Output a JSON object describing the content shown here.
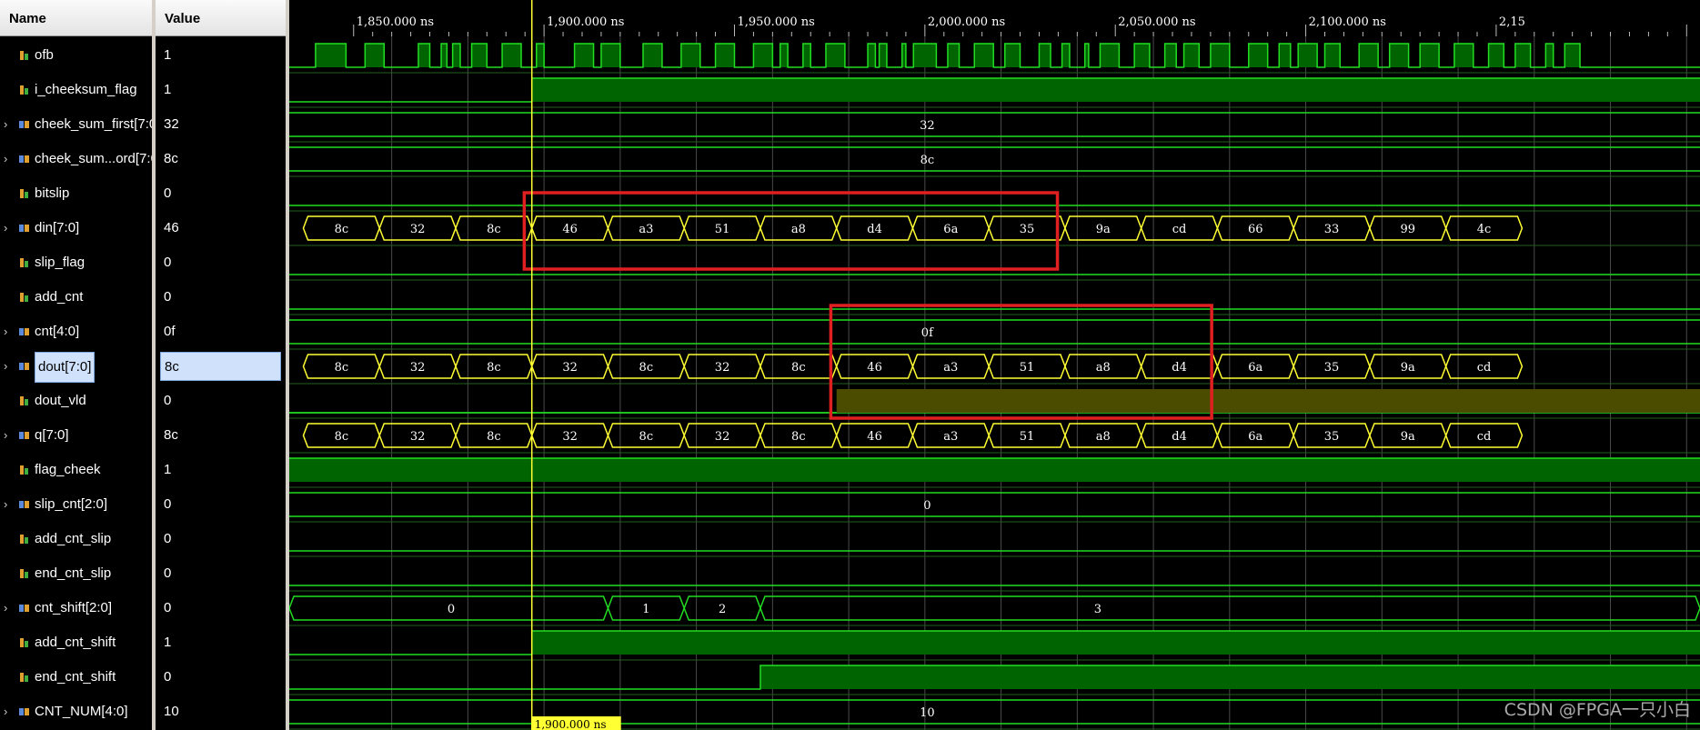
{
  "headers": {
    "name": "Name",
    "value": "Value"
  },
  "cursor_label": "1,900.000 ns",
  "timeline": {
    "ticks": [
      {
        "t": 1850,
        "label": "1,850.000 ns"
      },
      {
        "t": 1900,
        "label": "1,900.000 ns"
      },
      {
        "t": 1950,
        "label": "1,950.000 ns"
      },
      {
        "t": 2000,
        "label": "2,000.000 ns"
      },
      {
        "t": 2050,
        "label": "2,050.000 ns"
      },
      {
        "t": 2100,
        "label": "2,100.000 ns"
      },
      {
        "t": 2150,
        "label": "2,15"
      }
    ]
  },
  "signals": [
    {
      "name": "ofb",
      "value": "1",
      "bus": false
    },
    {
      "name": "i_cheeksum_flag",
      "value": "1",
      "bus": false
    },
    {
      "name": "cheek_sum_first[7:0]",
      "value": "32",
      "bus": true
    },
    {
      "name": "cheek_sum...ord[7:0]",
      "value": "8c",
      "bus": true
    },
    {
      "name": "bitslip",
      "value": "0",
      "bus": false
    },
    {
      "name": "din[7:0]",
      "value": "46",
      "bus": true
    },
    {
      "name": "slip_flag",
      "value": "0",
      "bus": false
    },
    {
      "name": "add_cnt",
      "value": "0",
      "bus": false
    },
    {
      "name": "cnt[4:0]",
      "value": "0f",
      "bus": true
    },
    {
      "name": "dout[7:0]",
      "value": "8c",
      "bus": true,
      "selected": true
    },
    {
      "name": "dout_vld",
      "value": "0",
      "bus": false
    },
    {
      "name": "q[7:0]",
      "value": "8c",
      "bus": true
    },
    {
      "name": "flag_cheek",
      "value": "1",
      "bus": false
    },
    {
      "name": "slip_cnt[2:0]",
      "value": "0",
      "bus": true
    },
    {
      "name": "add_cnt_slip",
      "value": "0",
      "bus": false
    },
    {
      "name": "end_cnt_slip",
      "value": "0",
      "bus": false
    },
    {
      "name": "cnt_shift[2:0]",
      "value": "0",
      "bus": true
    },
    {
      "name": "add_cnt_shift",
      "value": "1",
      "bus": false
    },
    {
      "name": "end_cnt_shift",
      "value": "0",
      "bus": false
    },
    {
      "name": "CNT_NUM[4:0]",
      "value": "10",
      "bus": true
    }
  ],
  "waves": {
    "cheek_sum_first": "32",
    "cheek_sum_second": "8c",
    "din": [
      "8c",
      "32",
      "8c",
      "46",
      "a3",
      "51",
      "a8",
      "d4",
      "6a",
      "35",
      "9a",
      "cd",
      "66",
      "33",
      "99",
      "4c"
    ],
    "cnt": "0f",
    "dout": [
      "8c",
      "32",
      "8c",
      "32",
      "8c",
      "32",
      "8c",
      "46",
      "a3",
      "51",
      "a8",
      "d4",
      "6a",
      "35",
      "9a",
      "cd"
    ],
    "q": [
      "8c",
      "32",
      "8c",
      "32",
      "8c",
      "32",
      "8c",
      "46",
      "a3",
      "51",
      "a8",
      "d4",
      "6a",
      "35",
      "9a",
      "cd"
    ],
    "slip_cnt": "0",
    "cnt_shift": [
      "0",
      "1",
      "2",
      "3"
    ],
    "cnt_num": "10"
  },
  "colors": {
    "bit": "#22dd22",
    "bus": "#ffff33",
    "fill": "#006400",
    "dout_vld_fill": "#4c4c00",
    "cursor": "#ffff33",
    "highlight": "#e02020"
  },
  "watermark": "CSDN @FPGA一只小白"
}
